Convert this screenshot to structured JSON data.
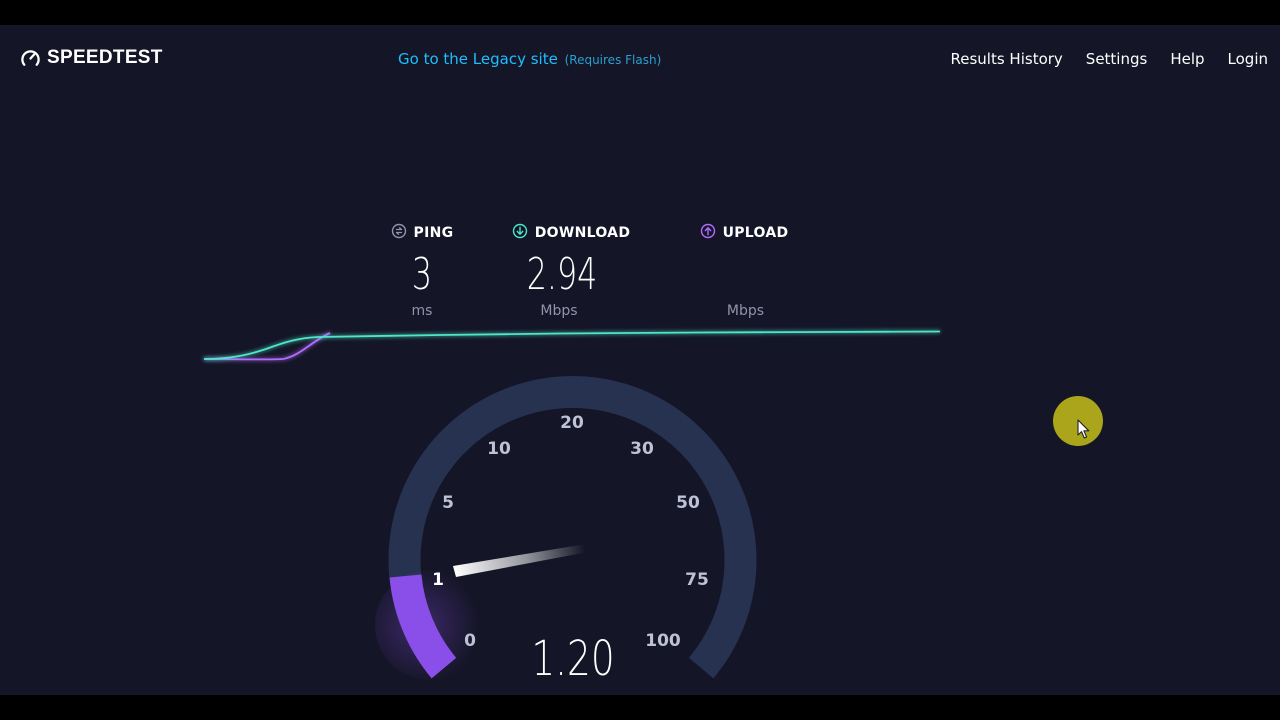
{
  "header": {
    "logo_text": "SPEEDTEST",
    "legacy_link": "Go to the Legacy site",
    "legacy_note": "(Requires Flash)",
    "nav": [
      "Results History",
      "Settings",
      "Help",
      "Login"
    ]
  },
  "metrics": {
    "ping": {
      "label": "PING",
      "value": "3",
      "unit": "ms",
      "icon": "ping-icon"
    },
    "download": {
      "label": "DOWNLOAD",
      "value": "2.94",
      "unit": "Mbps",
      "icon": "download-arrow-icon"
    },
    "upload": {
      "label": "UPLOAD",
      "value": "",
      "unit": "Mbps",
      "icon": "upload-arrow-icon"
    }
  },
  "gauge": {
    "scale": [
      "0",
      "1",
      "5",
      "10",
      "20",
      "30",
      "50",
      "75",
      "100"
    ],
    "current_reading": "1.20",
    "current_value": 1.2,
    "needle_scale_value": 1.2
  },
  "colors": {
    "background": "#141526",
    "download_accent": "#4ee6c8",
    "upload_accent": "#b36bff",
    "link": "#1cbfff",
    "gauge_track": "#263250",
    "gauge_fill": "#8a4fe8"
  }
}
